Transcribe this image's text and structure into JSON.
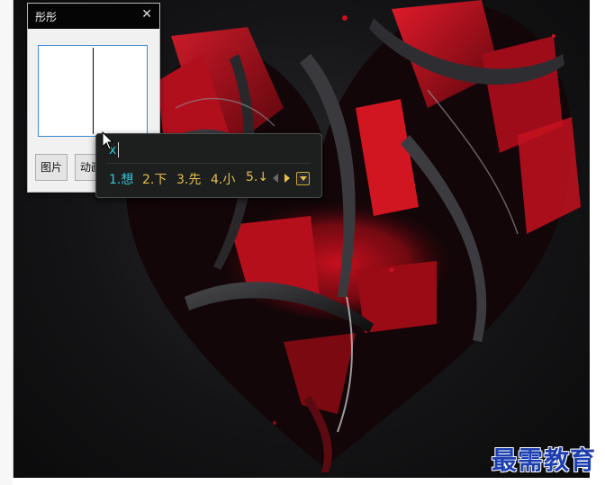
{
  "mini_window": {
    "title": "彤彤",
    "close_glyph": "✕",
    "buttons": {
      "image_label": "图片",
      "animation_label": "动画"
    }
  },
  "ime": {
    "input_text": "x",
    "candidates": [
      "1.想",
      "2.下",
      "3.先",
      "4.小",
      "5.↓"
    ],
    "colors": {
      "highlight": "#36c3d6",
      "normal": "#e6be4a",
      "background": "#1d1f1f"
    }
  },
  "wallpaper": {
    "subject": "red-black-3d-heart"
  },
  "watermark": "最需教育"
}
